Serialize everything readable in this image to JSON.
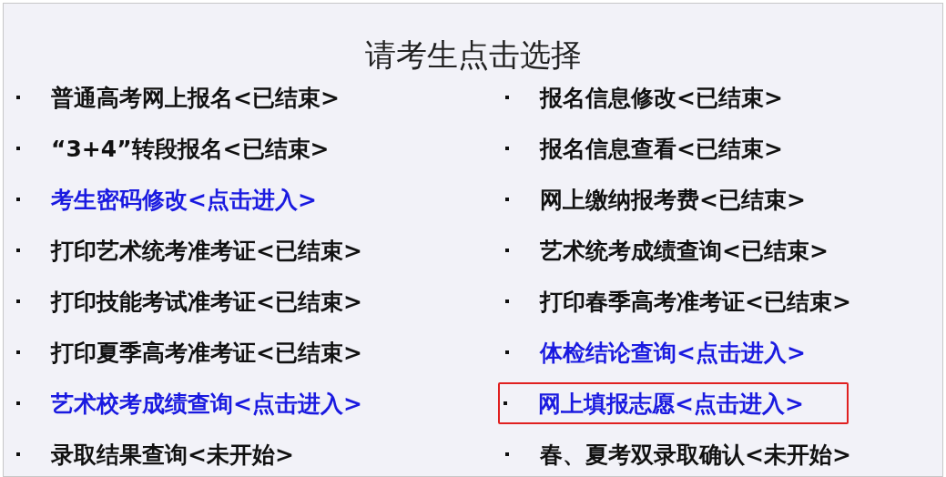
{
  "title": "请考生点击选择",
  "left_column": [
    {
      "label": "普通高考网上报名<已结束>",
      "kind": "closed",
      "highlighted": false
    },
    {
      "label": "“3+4”转段报名<已结束>",
      "kind": "closed",
      "highlighted": false
    },
    {
      "label": "考生密码修改<点击进入>",
      "kind": "link",
      "highlighted": false
    },
    {
      "label": "打印艺术统考准考证<已结束>",
      "kind": "closed",
      "highlighted": false
    },
    {
      "label": "打印技能考试准考证<已结束>",
      "kind": "closed",
      "highlighted": false
    },
    {
      "label": "打印夏季高考准考证<已结束>",
      "kind": "closed",
      "highlighted": false
    },
    {
      "label": "艺术校考成绩查询<点击进入>",
      "kind": "link",
      "highlighted": false
    },
    {
      "label": "录取结果查询<未开始>",
      "kind": "closed",
      "highlighted": false
    }
  ],
  "right_column": [
    {
      "label": "报名信息修改<已结束>",
      "kind": "closed",
      "highlighted": false
    },
    {
      "label": "报名信息查看<已结束>",
      "kind": "closed",
      "highlighted": false
    },
    {
      "label": "网上缴纳报考费<已结束>",
      "kind": "closed",
      "highlighted": false
    },
    {
      "label": "艺术统考成绩查询<已结束>",
      "kind": "closed",
      "highlighted": false
    },
    {
      "label": "打印春季高考准考证<已结束>",
      "kind": "closed",
      "highlighted": false
    },
    {
      "label": "体检结论查询<点击进入>",
      "kind": "link",
      "highlighted": false
    },
    {
      "label": "网上填报志愿<点击进入>",
      "kind": "link",
      "highlighted": true
    },
    {
      "label": "春、夏考双录取确认<未开始>",
      "kind": "closed",
      "highlighted": false
    }
  ]
}
